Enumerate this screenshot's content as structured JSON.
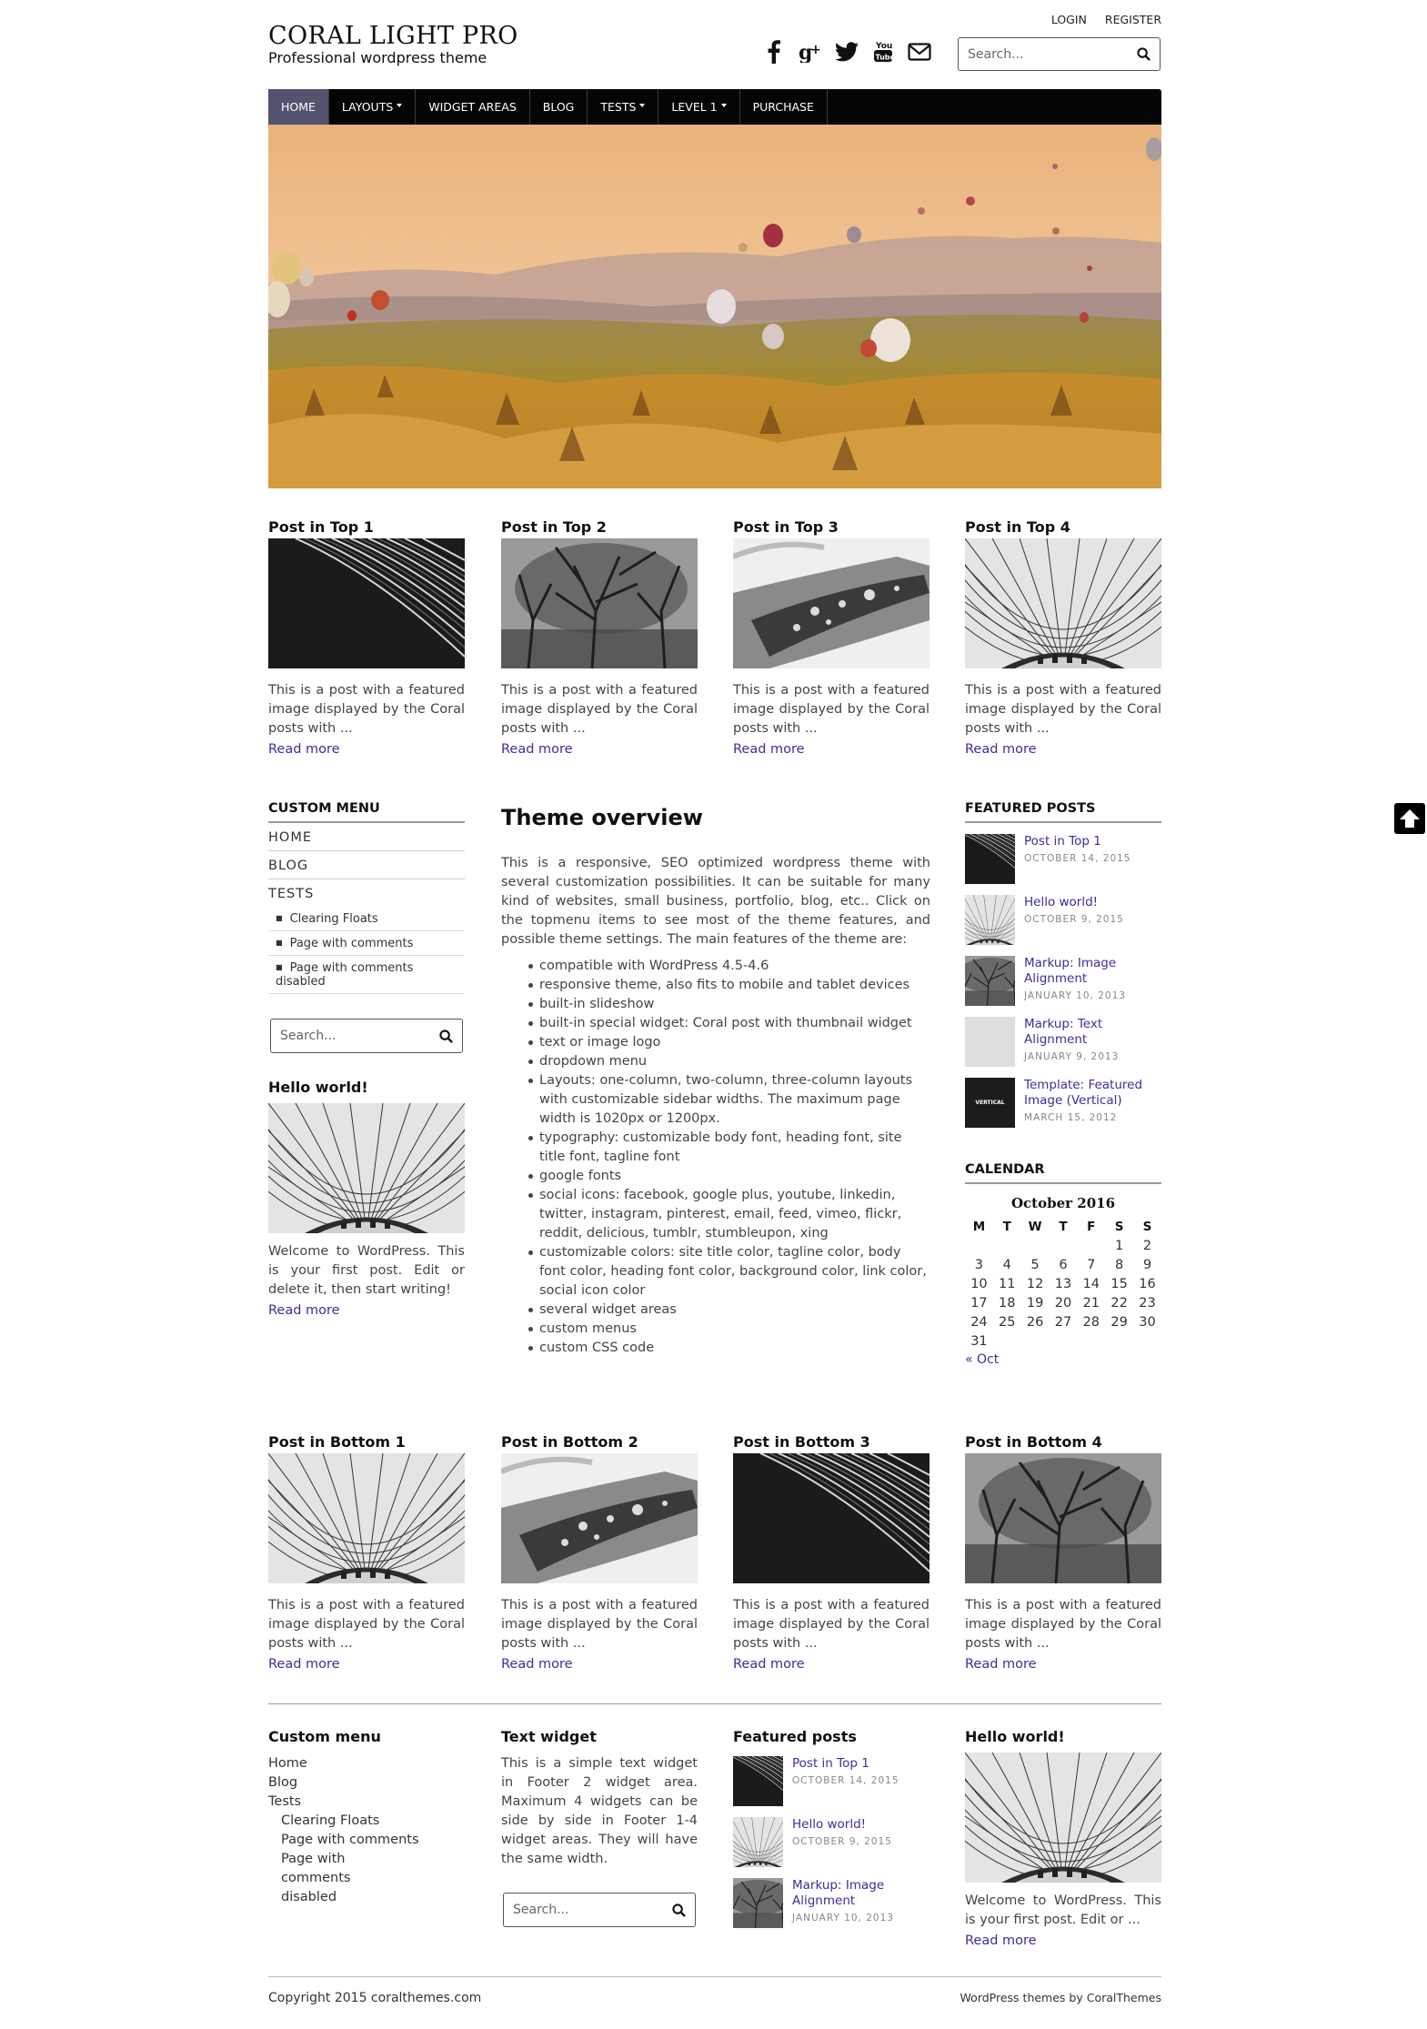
{
  "header": {
    "site_title": "CORAL LIGHT PRO",
    "tagline": "Professional wordpress theme",
    "top_links": [
      "LOGIN",
      "REGISTER"
    ],
    "social_icons": [
      "facebook-icon",
      "google-plus-icon",
      "twitter-icon",
      "youtube-icon",
      "email-icon"
    ],
    "search_placeholder": "Search..."
  },
  "nav": {
    "items": [
      {
        "label": "HOME",
        "active": true
      },
      {
        "label": "LAYOUTS",
        "dropdown": true
      },
      {
        "label": "WIDGET AREAS"
      },
      {
        "label": "BLOG"
      },
      {
        "label": "TESTS",
        "dropdown": true
      },
      {
        "label": "LEVEL 1",
        "dropdown": true
      },
      {
        "label": "PURCHASE"
      }
    ]
  },
  "top_posts": [
    {
      "title": "Post in Top 1",
      "excerpt": "This is a post with a featured image displayed by the Coral posts with ...",
      "more": "Read more",
      "image": "curved-building-bw"
    },
    {
      "title": "Post in Top 2",
      "excerpt": "This is a post with a featured image displayed by the Coral posts with ...",
      "more": "Read more",
      "image": "misty-tree-bw"
    },
    {
      "title": "Post in Top 3",
      "excerpt": "This is a post with a featured image displayed by the Coral posts with ...",
      "more": "Read more",
      "image": "rusty-car-bw"
    },
    {
      "title": "Post in Top 4",
      "excerpt": "This is a post with a featured image displayed by the Coral posts with ...",
      "more": "Read more",
      "image": "glass-dome-bw"
    }
  ],
  "left_sidebar": {
    "menu_title": "CUSTOM MENU",
    "menu_items": [
      "HOME",
      "BLOG",
      "TESTS"
    ],
    "sub_items": [
      "Clearing Floats",
      "Page with comments",
      "Page with comments disabled"
    ],
    "search_placeholder": "Search...",
    "post_title": "Hello world!",
    "post_excerpt": "Welcome to WordPress. This is your first post. Edit or delete it, then start writing!",
    "post_more": "Read more"
  },
  "content": {
    "title": "Theme overview",
    "intro": "This is a responsive, SEO optimized wordpress theme with several customization possibilities. It can be suitable for many kind of websites, small business, portfolio, blog, etc.. Click on the topmenu items to see most of the theme features, and possible theme settings. The main features of the theme are:",
    "features": [
      "compatible with WordPress 4.5-4.6",
      "responsive theme, also fits to mobile and tablet devices",
      "built-in slideshow",
      "built-in special widget: Coral post with thumbnail widget",
      "text or image logo",
      "dropdown menu",
      "Layouts: one-column, two-column, three-column layouts with customizable sidebar widths. The maximum page width is 1020px or 1200px.",
      "typography: customizable body font, heading font, site title font, tagline font",
      "google fonts",
      "social icons: facebook, google plus, youtube, linkedin, twitter, instagram, pinterest, email, feed, vimeo, flickr, reddit, delicious, tumblr, stumbleupon, xing",
      "customizable colors: site title color, tagline color, body font color, heading font color, background color, link color, social icon color",
      "several widget areas",
      "custom menus",
      "custom CSS code"
    ]
  },
  "right_sidebar": {
    "featured_title": "FEATURED POSTS",
    "featured": [
      {
        "title": "Post in Top 1",
        "date": "OCTOBER 14, 2015",
        "image": "curved-building-bw"
      },
      {
        "title": "Hello world!",
        "date": "OCTOBER 9, 2015",
        "image": "glass-dome-bw"
      },
      {
        "title": "Markup: Image Alignment",
        "date": "JANUARY 10, 2013",
        "image": "misty-tree-bw"
      },
      {
        "title": "Markup: Text Alignment",
        "date": "JANUARY 9, 2013",
        "image": "blank-grey"
      },
      {
        "title": "Template: Featured Image (Vertical)",
        "date": "MARCH 15, 2012",
        "image": "vertical-dark"
      }
    ],
    "vertical_thumb_text": "VERTICAL",
    "calendar_title": "CALENDAR",
    "calendar_caption": "October 2016",
    "calendar_days": [
      "M",
      "T",
      "W",
      "T",
      "F",
      "S",
      "S"
    ],
    "calendar_weeks": [
      [
        "",
        "",
        "",
        "",
        "",
        "1",
        "2"
      ],
      [
        "3",
        "4",
        "5",
        "6",
        "7",
        "8",
        "9"
      ],
      [
        "10",
        "11",
        "12",
        "13",
        "14",
        "15",
        "16"
      ],
      [
        "17",
        "18",
        "19",
        "20",
        "21",
        "22",
        "23"
      ],
      [
        "24",
        "25",
        "26",
        "27",
        "28",
        "29",
        "30"
      ],
      [
        "31",
        "",
        "",
        "",
        "",
        "",
        ""
      ]
    ],
    "calendar_prev": "« Oct"
  },
  "bottom_posts": [
    {
      "title": "Post in Bottom 1",
      "excerpt": "This is a post with a featured image displayed by the Coral posts with ...",
      "more": "Read more",
      "image": "glass-dome-bw"
    },
    {
      "title": "Post in Bottom 2",
      "excerpt": "This is a post with a featured image displayed by the Coral posts with ...",
      "more": "Read more",
      "image": "rusty-car-bw"
    },
    {
      "title": "Post in Bottom 3",
      "excerpt": "This is a post with a featured image displayed by the Coral posts with ...",
      "more": "Read more",
      "image": "curved-building-bw"
    },
    {
      "title": "Post in Bottom 4",
      "excerpt": "This is a post with a featured image displayed by the Coral posts with ...",
      "more": "Read more",
      "image": "misty-tree-bw"
    }
  ],
  "footer": {
    "menu_title": "Custom menu",
    "menu_items": [
      "Home",
      "Blog",
      "Tests"
    ],
    "menu_sub": [
      "Clearing Floats",
      "Page with comments",
      "Page with comments disabled"
    ],
    "text_title": "Text widget",
    "text_body": "This is a simple text widget in Footer 2 widget area. Maximum 4 widgets can be side by side in Footer 1-4 widget areas. They will have the same width.",
    "search_placeholder": "Search...",
    "featured_title": "Featured posts",
    "featured": [
      {
        "title": "Post in Top 1",
        "date": "OCTOBER 14, 2015",
        "image": "curved-building-bw"
      },
      {
        "title": "Hello world!",
        "date": "OCTOBER 9, 2015",
        "image": "glass-dome-bw"
      },
      {
        "title": "Markup: Image Alignment",
        "date": "JANUARY 10, 2013",
        "image": "misty-tree-bw"
      }
    ],
    "hello_title": "Hello world!",
    "hello_excerpt": "Welcome to WordPress. This is your first post. Edit or ...",
    "hello_more": "Read more",
    "copyright": "Copyright 2015 coralthemes.com",
    "credits": "WordPress themes by CoralThemes"
  },
  "colors": {
    "link": "#35329a",
    "nav_bg": "#050505",
    "nav_active": "#535370"
  }
}
